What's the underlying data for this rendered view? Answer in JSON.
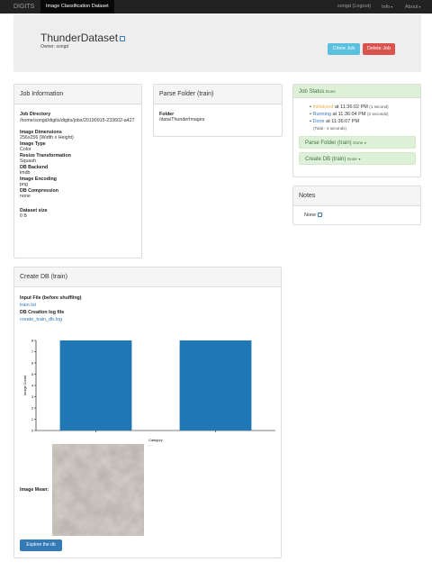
{
  "navbar": {
    "brand": "DIGITS",
    "active_tab": "Image Classification Dataset",
    "user": "songd (Logout)",
    "info": "Info",
    "about": "About"
  },
  "header": {
    "title": "ThunderDataset",
    "owner": "Owner: songd",
    "clone_label": "Clone Job",
    "delete_label": "Delete Job"
  },
  "job_info": {
    "heading": "Job Information",
    "fields": [
      {
        "label": "Job Directory",
        "value": "/home/songd/digits/digits/jobs/20190915-233602-a427"
      },
      {
        "label": "Image Dimensions",
        "value": "256x256 (Width x Height)"
      },
      {
        "label": "Image Type",
        "value": "Color"
      },
      {
        "label": "Resize Transformation",
        "value": "Squash"
      },
      {
        "label": "DB Backend",
        "value": "lmdb"
      },
      {
        "label": "Image Encoding",
        "value": "png"
      },
      {
        "label": "DB Compression",
        "value": "none"
      },
      {
        "label": "Dataset size",
        "value": "0 B"
      }
    ]
  },
  "parse_folder": {
    "heading": "Parse Folder (train)",
    "folder_label": "Folder",
    "folder_value": "/data/ThunderImages"
  },
  "job_status": {
    "heading": "Job Status",
    "state": "Done",
    "events": [
      {
        "state": "Initialized",
        "time": "at 11:36:02 PM",
        "duration": "(1 second)",
        "color": "#f0ad4e"
      },
      {
        "state": "Running",
        "time": "at 11:36:04 PM",
        "duration": "(3 seconds)",
        "color": "#337ab7"
      },
      {
        "state": "Done",
        "time": "at 11:36:07 PM",
        "duration": "",
        "color": "#337ab7"
      }
    ],
    "total": "(Total - 4 seconds)",
    "sub_tasks": [
      {
        "label": "Parse Folder (train)",
        "state": "Done"
      },
      {
        "label": "Create DB (train)",
        "state": "Done"
      }
    ]
  },
  "notes": {
    "heading": "Notes",
    "value": "None"
  },
  "create_db": {
    "heading": "Create DB (train)",
    "input_file_label": "Input File (before shuffling)",
    "input_file_link": "train.txt",
    "log_label": "DB Creation log file",
    "log_link": "create_train_db.log",
    "image_mean_label": "Image Mean:",
    "explore_label": "Explore the db"
  },
  "chart_data": {
    "type": "bar",
    "categories": [
      "",
      ""
    ],
    "values": [
      8,
      8
    ],
    "xlabel": "Category",
    "ylabel": "Image Count",
    "ylim": [
      0,
      8
    ],
    "yticks": [
      0,
      1,
      2,
      3,
      4,
      5,
      6,
      7,
      8
    ],
    "bar_color": "#1f77b4"
  }
}
